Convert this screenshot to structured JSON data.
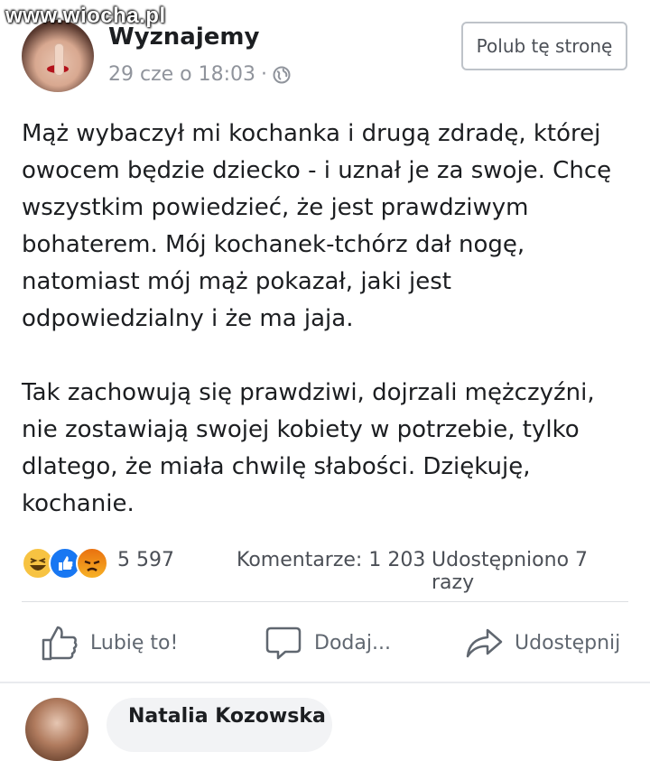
{
  "watermark": "www.wiocha.pl",
  "post": {
    "page_name": "Wyznajemy",
    "timestamp": "29 cze o 18:03",
    "meta_separator": "·",
    "privacy_icon": "globe-icon",
    "like_page_button": "Polub tę stronę",
    "paragraphs": [
      "Mąż wybaczył mi kochanka i drugą zdradę, której owocem będzie dziecko - i uznał je za swoje. Chcę wszystkim powiedzieć, że jest prawdziwym bohaterem. Mój kochanek-tchórz dał nogę, natomiast mój mąż pokazał, jaki jest odpowiedzialny i że ma jaja.",
      "Tak zachowują się prawdziwi, dojrzali mężczyźni, nie zostawiają swojej kobiety w potrzebie, tylko dlatego, że miała chwilę słabości. Dziękuję, kochanie."
    ]
  },
  "reactions": {
    "icons": [
      "haha-icon",
      "like-icon",
      "angry-icon"
    ],
    "count": "5 597",
    "comments": "Komentarze: 1 203",
    "shares": "Udostępniono 7 razy"
  },
  "actions": {
    "like": "Lubię to!",
    "comment": "Dodaj...",
    "share": "Udostępnij"
  },
  "comment_preview": {
    "name": "Natalia Kozowska"
  },
  "colors": {
    "text": "#1c1e21",
    "meta": "#90949c",
    "like_blue": "#1877f2",
    "divider": "#dddfe2"
  }
}
